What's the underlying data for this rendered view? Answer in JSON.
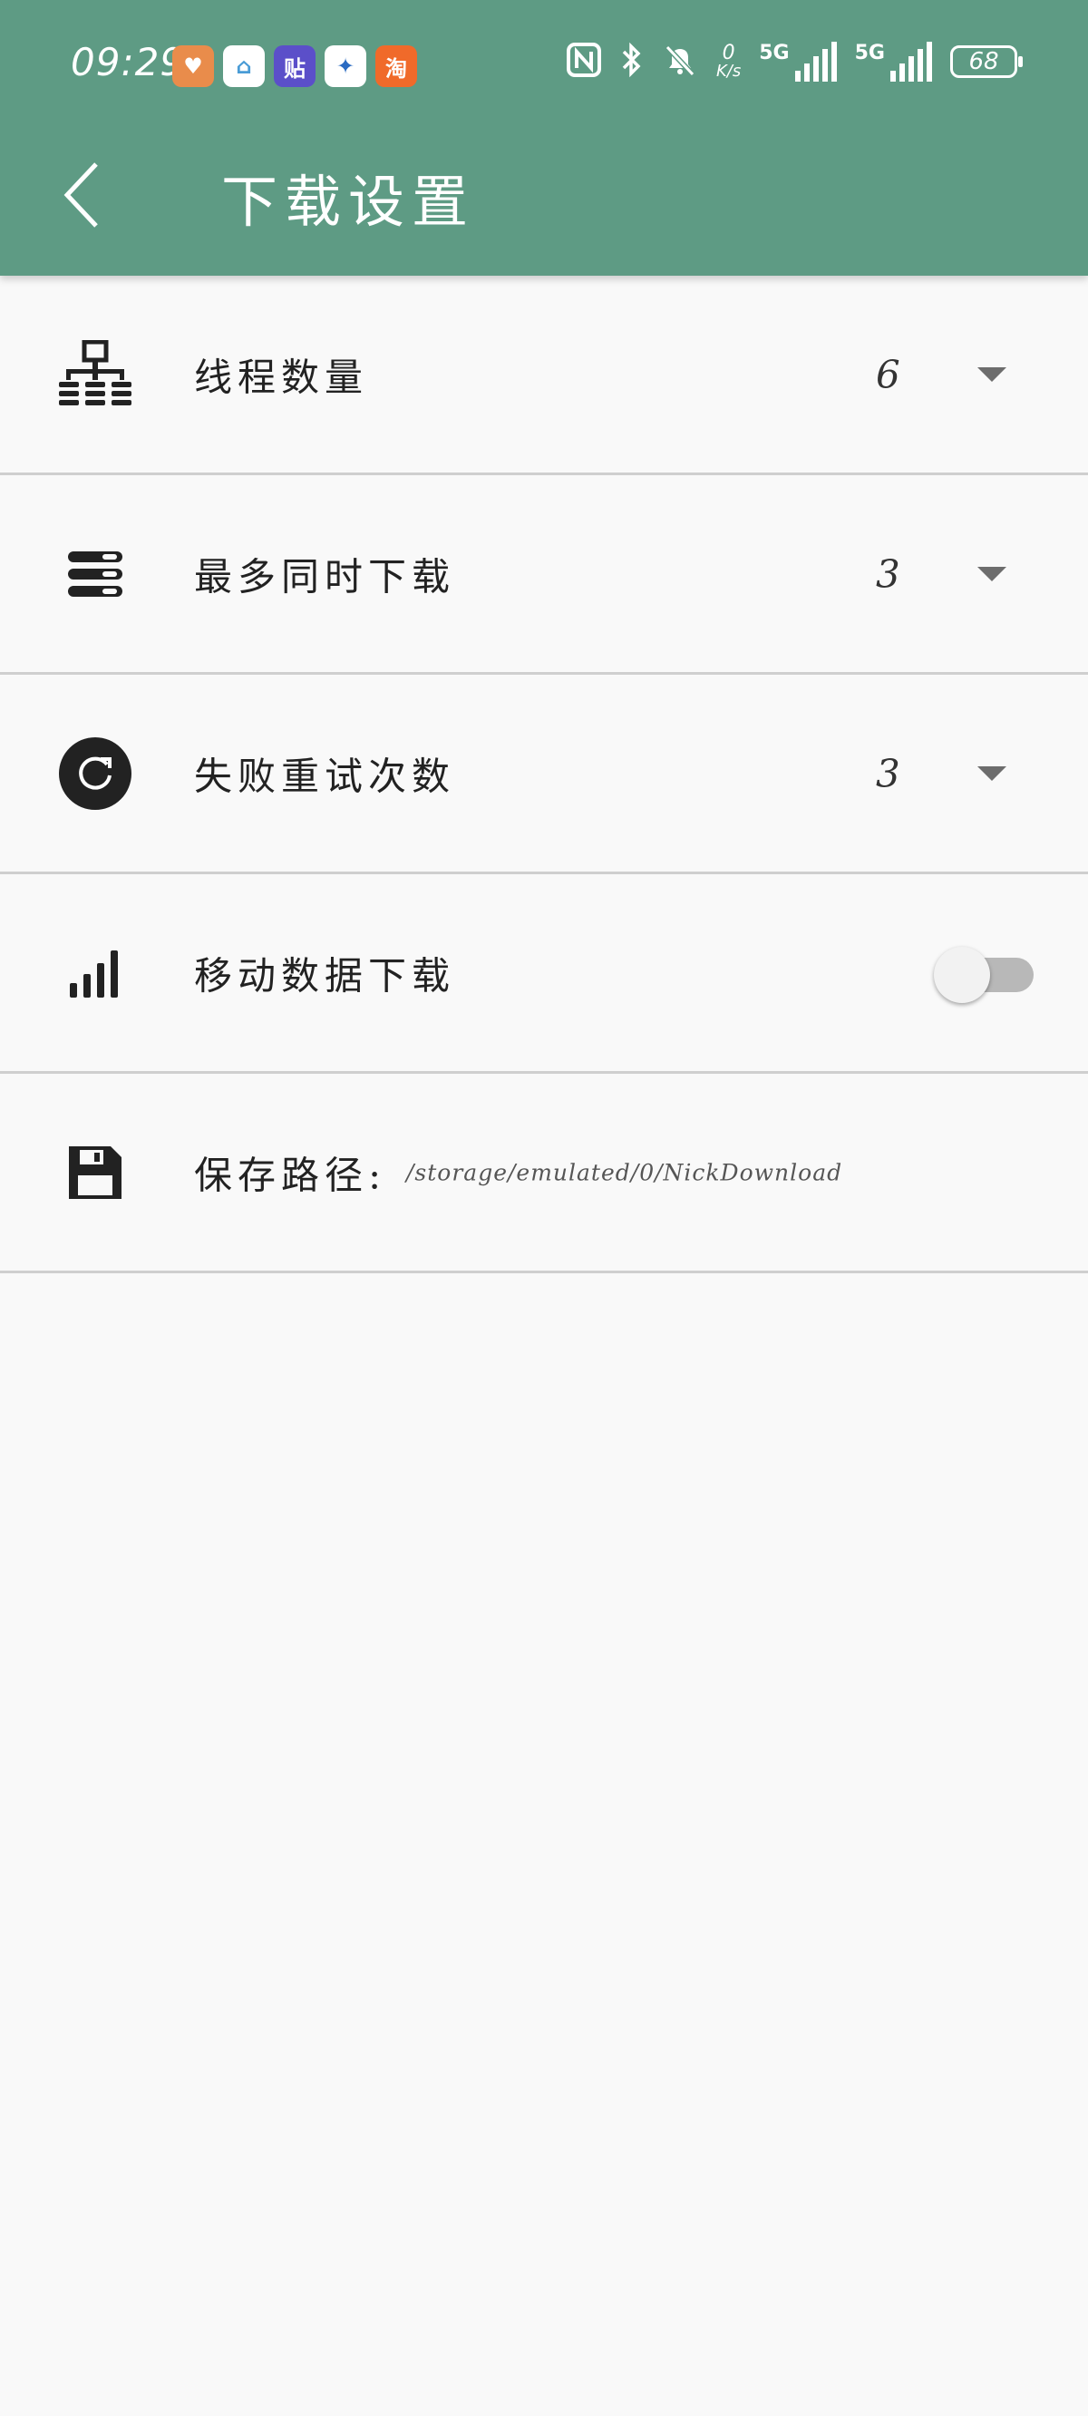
{
  "status_bar": {
    "time": "09:29",
    "notifications": [
      {
        "icon": "health-app-icon",
        "color": "#e98c4b",
        "glyph": "♥"
      },
      {
        "icon": "smart-home-app-icon",
        "color": "#ffffff",
        "glyph": "⌂"
      },
      {
        "icon": "tieba-app-icon",
        "color": "#5b4fc9",
        "glyph": "贴"
      },
      {
        "icon": "delivery-app-icon",
        "color": "#ffffff",
        "glyph": "✦"
      },
      {
        "icon": "taobao-app-icon",
        "color": "#f06a2a",
        "glyph": "淘"
      }
    ],
    "net_speed_value": "0",
    "net_speed_unit": "K/s",
    "signal_1_label": "5G",
    "signal_2_label": "5G",
    "battery": "68"
  },
  "header": {
    "title": "下载设置",
    "background_color": "#5e9b84"
  },
  "settings": {
    "threads": {
      "label": "线程数量",
      "value": "6",
      "icon": "network-tree-icon"
    },
    "max_concurrent": {
      "label": "最多同时下载",
      "value": "3",
      "icon": "stacked-list-icon"
    },
    "retry_count": {
      "label": "失败重试次数",
      "value": "3",
      "icon": "refresh-circle-icon"
    },
    "mobile_data": {
      "label": "移动数据下载",
      "enabled": false,
      "icon": "signal-bars-icon"
    },
    "save_path": {
      "label": "保存路径:",
      "value": "/storage/emulated/0/NickDownload",
      "icon": "floppy-disk-icon"
    }
  }
}
